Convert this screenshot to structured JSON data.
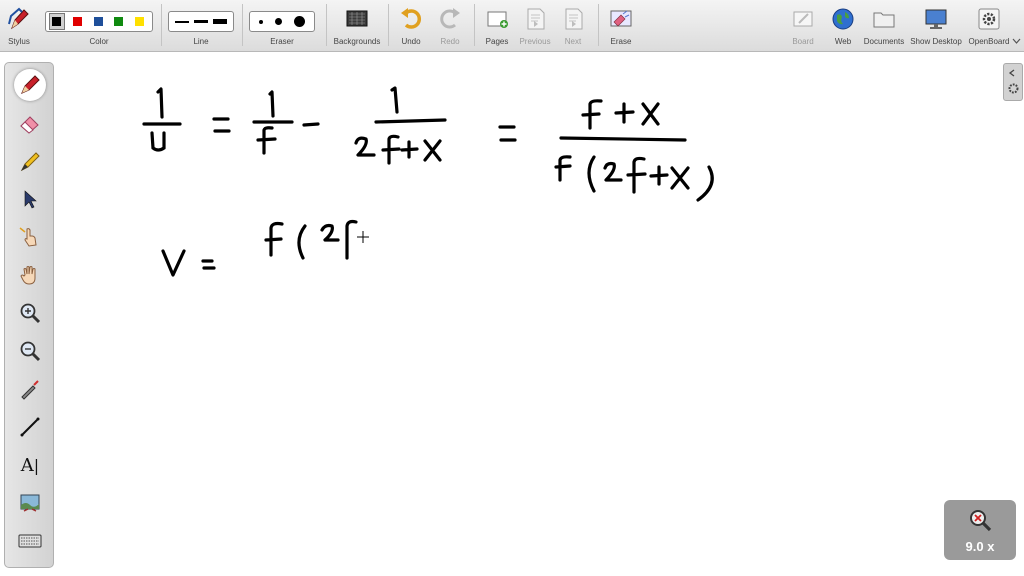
{
  "toolbar": {
    "stylus_label": "Stylus",
    "color_label": "Color",
    "line_label": "Line",
    "eraser_label": "Eraser",
    "backgrounds_label": "Backgrounds",
    "undo_label": "Undo",
    "redo_label": "Redo",
    "pages_label": "Pages",
    "previous_label": "Previous",
    "next_label": "Next",
    "erase_label": "Erase",
    "board_label": "Board",
    "web_label": "Web",
    "documents_label": "Documents",
    "show_desktop_label": "Show Desktop",
    "openboard_label": "OpenBoard",
    "colors": [
      "#000000",
      "#e00000",
      "#1f4f9a",
      "#108a10",
      "#ffe000"
    ],
    "selected_color_index": 0
  },
  "sidebar": {
    "tools": [
      "pen-icon",
      "eraser-icon",
      "highlighter-icon",
      "pointer-icon",
      "laser-hand-icon",
      "hand-icon",
      "zoom-in-icon",
      "zoom-out-icon",
      "laser-pointer-icon",
      "line-icon",
      "text-icon",
      "capture-icon",
      "keyboard-icon"
    ],
    "active_index": 0,
    "text_tool_glyph": "A"
  },
  "zoom": {
    "level": "9.0 x"
  }
}
